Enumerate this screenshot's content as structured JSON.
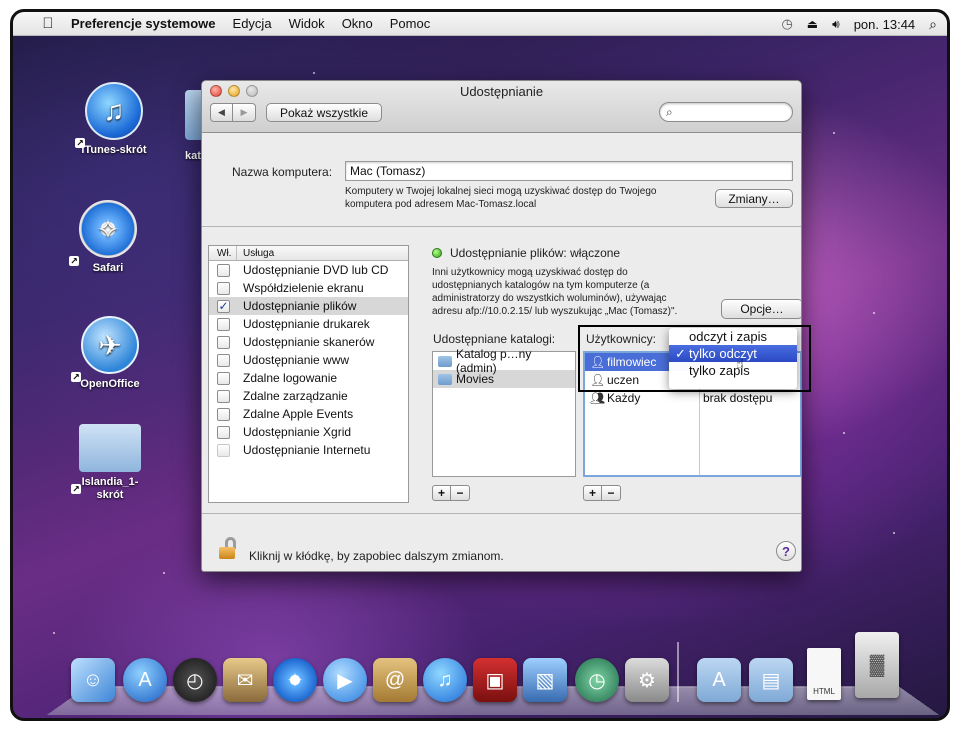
{
  "menubar": {
    "app_name": "Preferencje systemowe",
    "menus": [
      "Edycja",
      "Widok",
      "Okno",
      "Pomoc"
    ],
    "clock": "pon. 13:44"
  },
  "desktop": {
    "icons": [
      {
        "label": "iTunes-skrót",
        "icon": "itunes-icon"
      },
      {
        "label": "Safari",
        "icon": "safari-icon"
      },
      {
        "label": "OpenOffice",
        "icon": "openoffice-icon"
      },
      {
        "label": "Islandia_1-skrót",
        "icon": "folder-icon"
      }
    ],
    "partial_label": "kat"
  },
  "window": {
    "title": "Udostępnianie",
    "show_all": "Pokaż wszystkie",
    "search_placeholder": "",
    "computer_name_label": "Nazwa komputera:",
    "computer_name_value": "Mac (Tomasz)",
    "computer_info_line1": "Komputery w Twojej lokalnej sieci mogą uzyskiwać dostęp do Twojego",
    "computer_info_line2": "komputera pod adresem Mac-Tomasz.local",
    "change_button": "Zmiany…",
    "services_header_on": "Wł.",
    "services_header_service": "Usługa",
    "services": [
      {
        "label": "Udostępnianie DVD lub CD",
        "checked": false
      },
      {
        "label": "Współdzielenie ekranu",
        "checked": false
      },
      {
        "label": "Udostępnianie plików",
        "checked": true
      },
      {
        "label": "Udostępnianie drukarek",
        "checked": false
      },
      {
        "label": "Udostępnianie skanerów",
        "checked": false
      },
      {
        "label": "Udostępnianie www",
        "checked": false
      },
      {
        "label": "Zdalne logowanie",
        "checked": false
      },
      {
        "label": "Zdalne zarządzanie",
        "checked": false
      },
      {
        "label": "Zdalne Apple Events",
        "checked": false
      },
      {
        "label": "Udostępnianie Xgrid",
        "checked": false
      },
      {
        "label": "Udostępnianie Internetu",
        "checked": false
      }
    ],
    "status_title": "Udostępnianie plików: włączone",
    "status_desc_line1": "Inni użytkownicy mogą uzyskiwać dostęp do",
    "status_desc_line2": "udostępnianych katalogów na tym komputerze (a",
    "status_desc_line3": "administratorzy do wszystkich woluminów), używając",
    "status_desc_line4": "adresu afp://10.0.2.15/ lub wyszukując „Mac (Tomasz)\".",
    "options_button": "Opcje…",
    "shared_folders_label": "Udostępniane katalogi:",
    "shared_folders": [
      "Katalog p…ny (admin)",
      "Movies"
    ],
    "users_label": "Użytkownicy:",
    "users": [
      {
        "name": "filmowiec",
        "perm": ""
      },
      {
        "name": "uczen",
        "perm": ""
      },
      {
        "name": "Każdy",
        "perm": "brak dostępu"
      }
    ],
    "plus": "+",
    "minus": "−",
    "lock_text": "Kliknij w kłódkę, by zapobiec dalszym zmianom.",
    "help": "?"
  },
  "popup_menu": {
    "items": [
      "odczyt i zapis",
      "tylko odczyt",
      "tylko zapis"
    ],
    "selected_index": 1,
    "checkmark": "✓"
  },
  "dock": {
    "items": [
      "finder-icon",
      "app-store-icon",
      "dashboard-icon",
      "mail-stamp-icon",
      "safari-icon",
      "ichat-icon",
      "address-book-icon",
      "itunes-icon",
      "photo-booth-icon",
      "iphoto-icon",
      "time-machine-icon",
      "system-preferences-icon",
      "applications-folder-icon",
      "documents-folder-icon",
      "html-file-icon",
      "trash-icon"
    ],
    "html_file_label": "HTML"
  }
}
